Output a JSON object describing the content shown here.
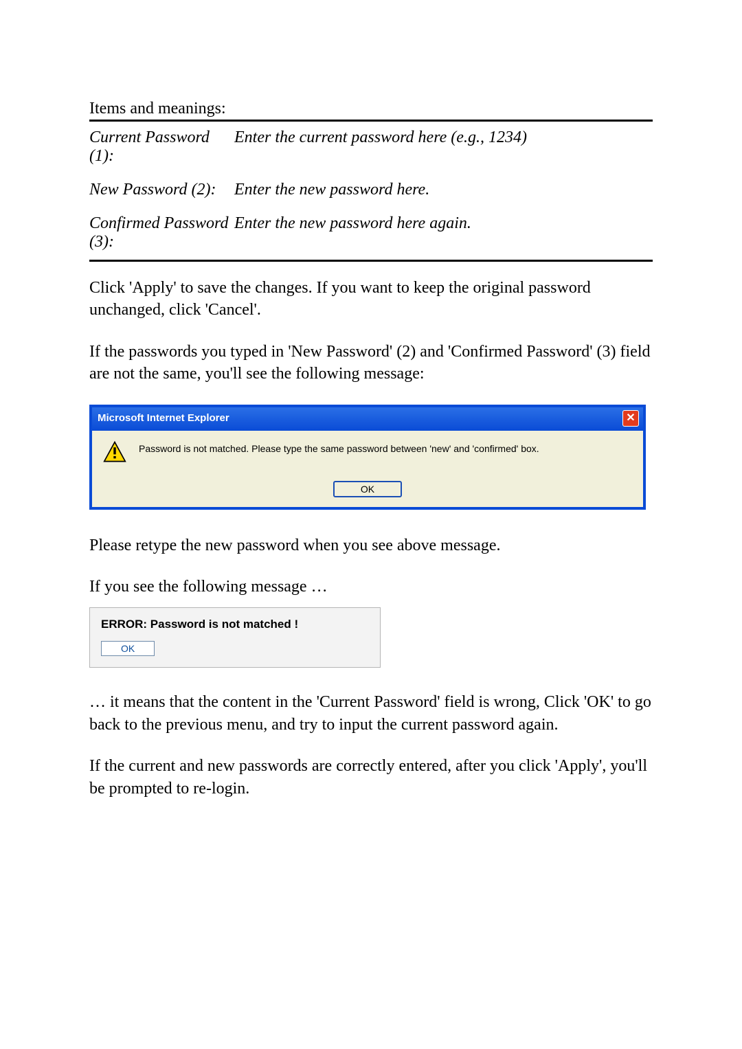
{
  "heading": "Items and meanings:",
  "defs": {
    "row1": {
      "term": "Current Password (1):",
      "desc": "Enter the current password here (e.g., 1234)"
    },
    "row2": {
      "term": "New Password (2):",
      "desc": "Enter the new password here."
    },
    "row3": {
      "term": "Confirmed Password (3):",
      "desc": "Enter the new password here again."
    }
  },
  "para1": "Click 'Apply' to save the changes. If you want to keep the original password unchanged, click 'Cancel'.",
  "para2": "If the passwords you typed in 'New Password' (2) and 'Confirmed Password' (3) field are not the same, you'll see the following message:",
  "dialog1": {
    "title": "Microsoft Internet Explorer",
    "close_glyph": "✕",
    "message": "Password is not matched. Please type the same password between 'new' and 'confirmed' box.",
    "ok_label": "OK"
  },
  "para3": "Please retype the new password when you see above message.",
  "para4": "If you see the following message …",
  "dialog2": {
    "title": "ERROR: Password is not matched !",
    "ok_label": "OK"
  },
  "para5": "… it means that the content in the 'Current Password' field is wrong, Click 'OK' to go back to the previous menu, and try to input the current password again.",
  "para6": "If the current and new passwords are correctly entered, after you click 'Apply', you'll be prompted to re-login."
}
